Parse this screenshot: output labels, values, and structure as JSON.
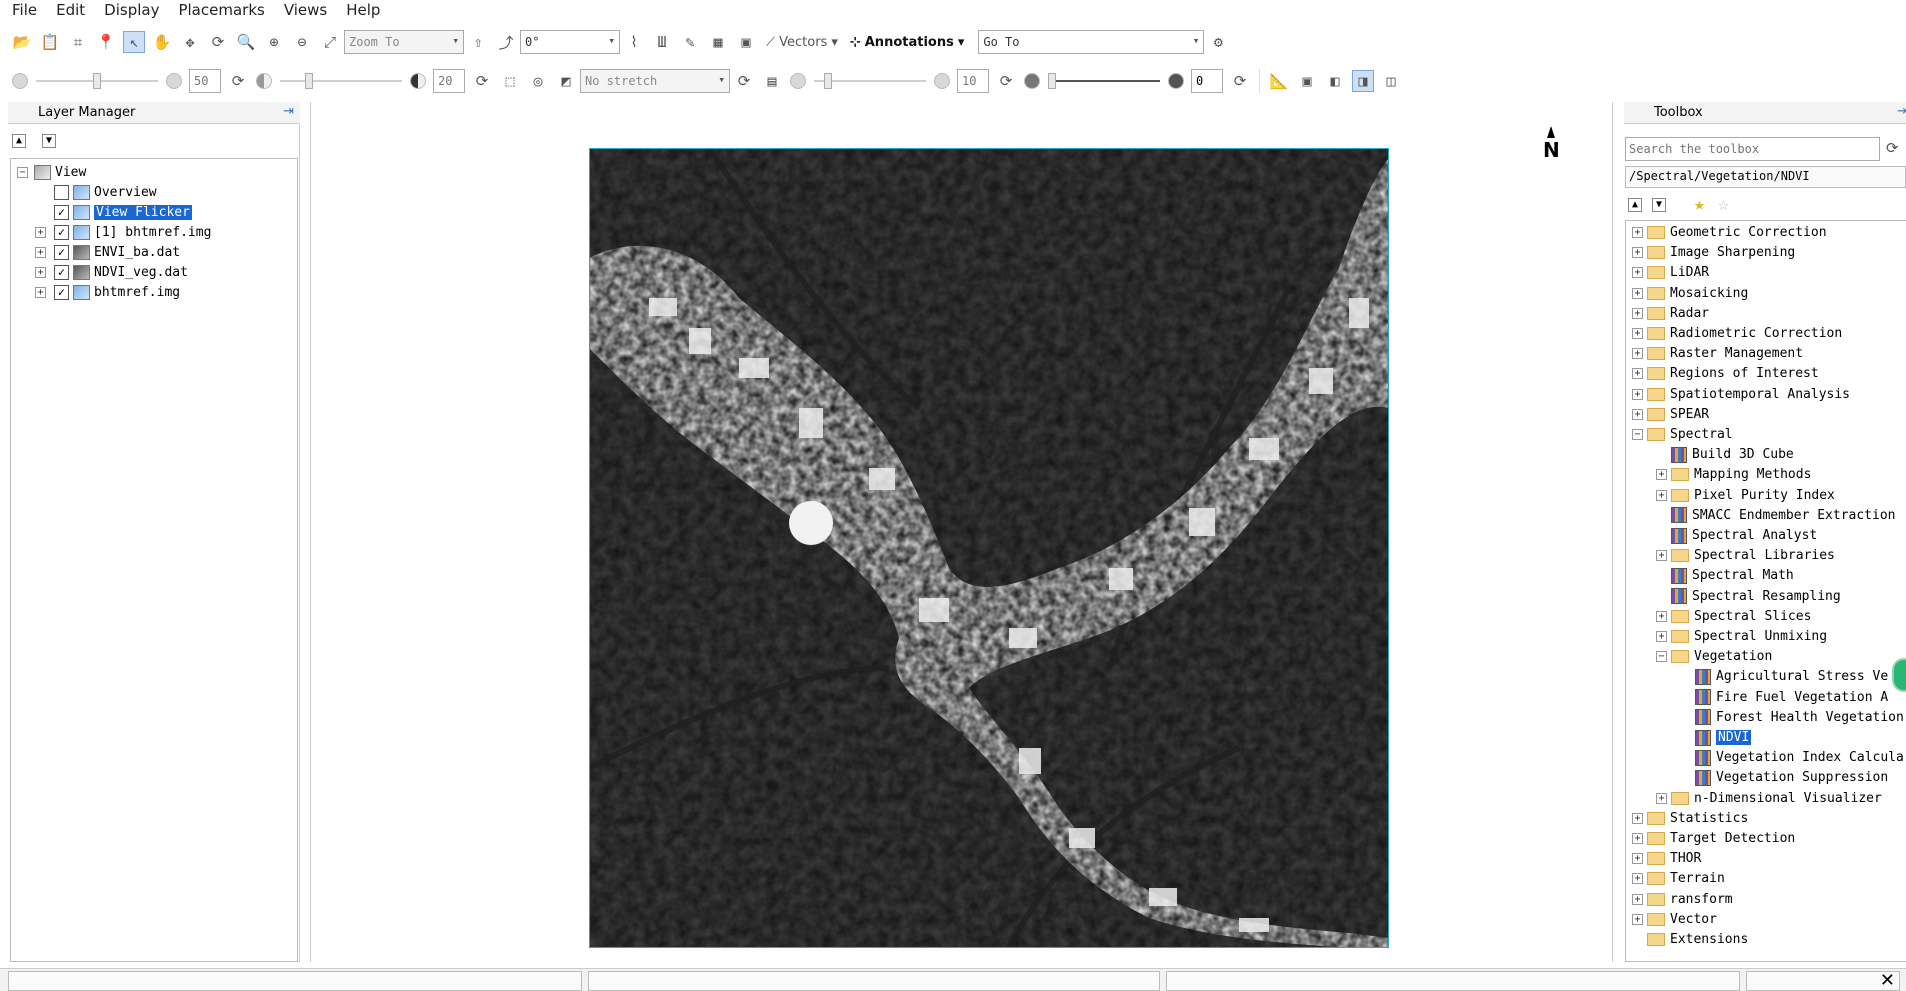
{
  "menu": [
    "File",
    "Edit",
    "Display",
    "Placemarks",
    "Views",
    "Help"
  ],
  "toolbar": {
    "zoom_combo": "Zoom To",
    "rotation": "0°",
    "vectors": "Vectors",
    "annotations": "Annotations",
    "goto": "Go To",
    "brightness": "50",
    "contrast": "20",
    "stretch": "No stretch",
    "sharpen": "10",
    "transparency": "0"
  },
  "layer_manager": {
    "title": "Layer Manager",
    "items": [
      {
        "label": "View",
        "checked": null,
        "selected": false,
        "level": 0
      },
      {
        "label": "Overview",
        "checked": false,
        "selected": false,
        "level": 1
      },
      {
        "label": "View Flicker",
        "checked": true,
        "selected": true,
        "level": 1
      },
      {
        "label": "[1] bhtmref.img",
        "checked": true,
        "selected": false,
        "level": 1
      },
      {
        "label": "ENVI_ba.dat",
        "checked": true,
        "selected": false,
        "level": 1
      },
      {
        "label": "NDVI_veg.dat",
        "checked": true,
        "selected": false,
        "level": 1
      },
      {
        "label": "bhtmref.img",
        "checked": true,
        "selected": false,
        "level": 1
      }
    ]
  },
  "toolbox": {
    "title": "Toolbox",
    "search_placeholder": "Search the toolbox",
    "path": "/Spectral/Vegetation/NDVI",
    "items": [
      {
        "label": "Geometric Correction",
        "type": "folder",
        "level": 0,
        "exp": "+"
      },
      {
        "label": "Image Sharpening",
        "type": "folder",
        "level": 0,
        "exp": "+"
      },
      {
        "label": "LiDAR",
        "type": "folder",
        "level": 0,
        "exp": "+"
      },
      {
        "label": "Mosaicking",
        "type": "folder",
        "level": 0,
        "exp": "+"
      },
      {
        "label": "Radar",
        "type": "folder",
        "level": 0,
        "exp": "+"
      },
      {
        "label": "Radiometric Correction",
        "type": "folder",
        "level": 0,
        "exp": "+"
      },
      {
        "label": "Raster Management",
        "type": "folder",
        "level": 0,
        "exp": "+"
      },
      {
        "label": "Regions of Interest",
        "type": "folder",
        "level": 0,
        "exp": "+"
      },
      {
        "label": "Spatiotemporal Analysis",
        "type": "folder",
        "level": 0,
        "exp": "+"
      },
      {
        "label": "SPEAR",
        "type": "folder",
        "level": 0,
        "exp": "+"
      },
      {
        "label": "Spectral",
        "type": "folder",
        "level": 0,
        "exp": "-"
      },
      {
        "label": "Build 3D Cube",
        "type": "tool",
        "level": 1,
        "exp": ""
      },
      {
        "label": "Mapping Methods",
        "type": "folder",
        "level": 1,
        "exp": "+"
      },
      {
        "label": "Pixel Purity Index",
        "type": "folder",
        "level": 1,
        "exp": "+"
      },
      {
        "label": "SMACC Endmember Extraction",
        "type": "tool",
        "level": 1,
        "exp": ""
      },
      {
        "label": "Spectral Analyst",
        "type": "tool",
        "level": 1,
        "exp": ""
      },
      {
        "label": "Spectral Libraries",
        "type": "folder",
        "level": 1,
        "exp": "+"
      },
      {
        "label": "Spectral Math",
        "type": "tool",
        "level": 1,
        "exp": ""
      },
      {
        "label": "Spectral Resampling",
        "type": "tool",
        "level": 1,
        "exp": ""
      },
      {
        "label": "Spectral Slices",
        "type": "folder",
        "level": 1,
        "exp": "+"
      },
      {
        "label": "Spectral Unmixing",
        "type": "folder",
        "level": 1,
        "exp": "+"
      },
      {
        "label": "Vegetation",
        "type": "folder",
        "level": 1,
        "exp": "-"
      },
      {
        "label": "Agricultural Stress Ve",
        "type": "tool",
        "level": 2,
        "exp": ""
      },
      {
        "label": "Fire Fuel Vegetation A",
        "type": "tool",
        "level": 2,
        "exp": ""
      },
      {
        "label": "Forest Health Vegetation",
        "type": "tool",
        "level": 2,
        "exp": ""
      },
      {
        "label": "NDVI",
        "type": "tool",
        "level": 2,
        "exp": "",
        "selected": true
      },
      {
        "label": "Vegetation Index Calcula",
        "type": "tool",
        "level": 2,
        "exp": ""
      },
      {
        "label": "Vegetation Suppression",
        "type": "tool",
        "level": 2,
        "exp": ""
      },
      {
        "label": "n-Dimensional Visualizer",
        "type": "folder",
        "level": 1,
        "exp": "+"
      },
      {
        "label": "Statistics",
        "type": "folder",
        "level": 0,
        "exp": "+"
      },
      {
        "label": "Target Detection",
        "type": "folder",
        "level": 0,
        "exp": "+"
      },
      {
        "label": "THOR",
        "type": "folder",
        "level": 0,
        "exp": "+"
      },
      {
        "label": "Terrain",
        "type": "folder",
        "level": 0,
        "exp": "+"
      },
      {
        "label": "ransform",
        "type": "folder",
        "level": 0,
        "exp": "+"
      },
      {
        "label": "Vector",
        "type": "folder",
        "level": 0,
        "exp": "+"
      },
      {
        "label": "Extensions",
        "type": "folder",
        "level": 0,
        "exp": ""
      }
    ]
  },
  "viewer": {
    "north_label": "N"
  }
}
